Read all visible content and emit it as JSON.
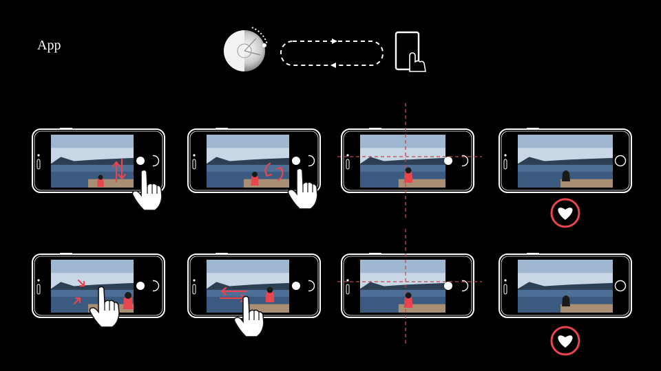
{
  "header": {
    "title": "App",
    "icons": [
      "camera-dial-icon",
      "sync-arrows-icon",
      "phone-touch-icon"
    ]
  },
  "colors": {
    "background": "#000000",
    "outline": "#ffffff",
    "accent": "#e8454f",
    "guide": "#c0494a"
  },
  "rows": [
    {
      "cells": [
        {
          "gesture": "drag-vertical",
          "icon": "vertical-drag-arrows-icon"
        },
        {
          "gesture": "rotate",
          "icon": "rotate-arrows-icon"
        },
        {
          "gesture": "align",
          "icon": "crosshair-guides"
        },
        {
          "gesture": "favorite",
          "icon": "heart-icon"
        }
      ]
    },
    {
      "cells": [
        {
          "gesture": "pinch",
          "icon": "pinch-arrows-icon"
        },
        {
          "gesture": "drag-horizontal",
          "icon": "horizontal-drag-arrows-icon"
        },
        {
          "gesture": "align",
          "icon": "crosshair-guides"
        },
        {
          "gesture": "favorite",
          "icon": "heart-icon"
        }
      ]
    }
  ]
}
